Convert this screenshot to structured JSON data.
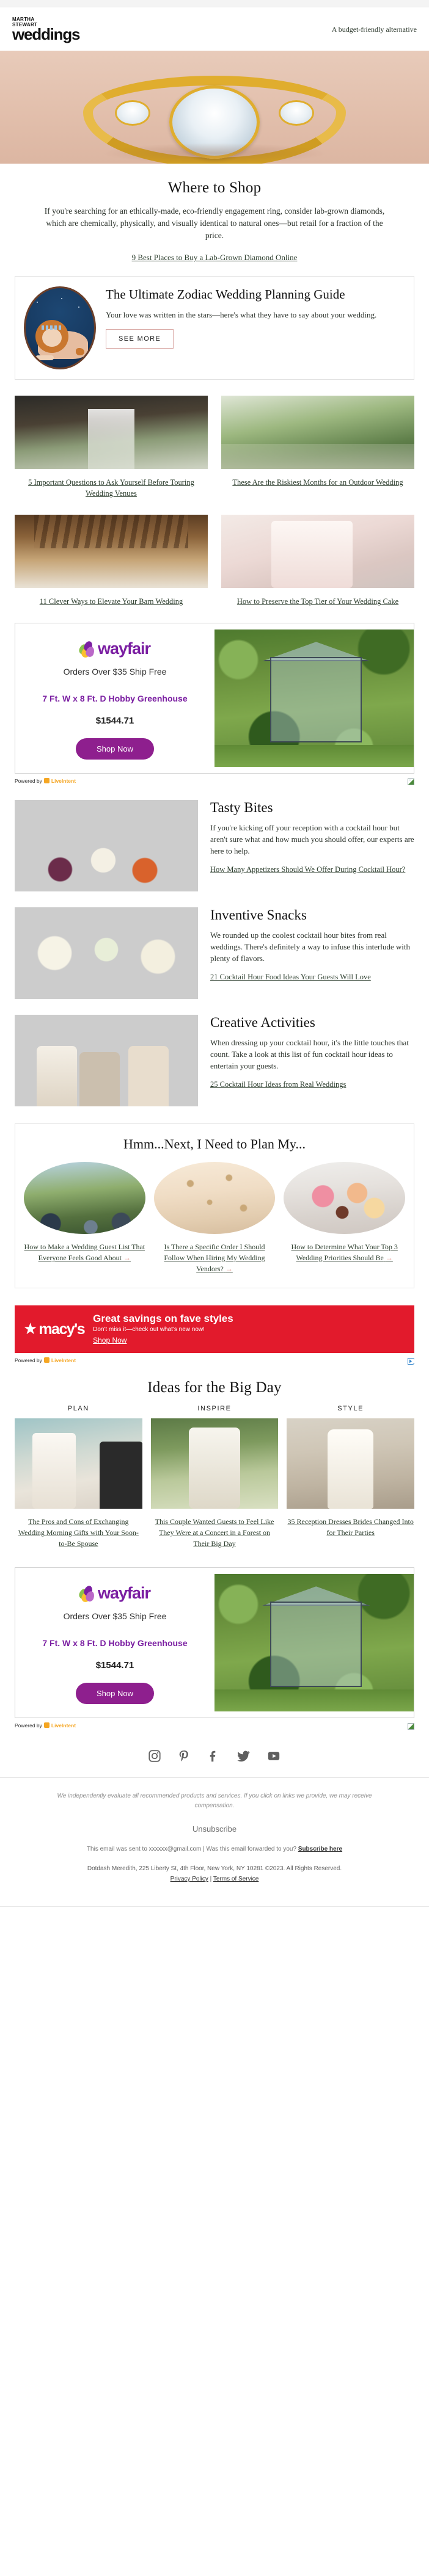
{
  "header": {
    "logo_line1": "MARTHA",
    "logo_line2": "STEWART",
    "logo_line3": "weddings",
    "preheader": "A budget-friendly alternative"
  },
  "hero": {
    "alt": "gold engagement ring with round diamond"
  },
  "where_to_shop": {
    "title": "Where to Shop",
    "body": "If you're searching for an ethically-made, eco-friendly engagement ring, consider lab-grown diamonds, which are chemically, physically, and visually identical to natural ones—but retail for a fraction of the price.",
    "link": "9 Best Places to Buy a Lab-Grown Diamond Online"
  },
  "zodiac_card": {
    "title": "The Ultimate Zodiac Wedding Planning Guide",
    "desc": "Your love was written in the stars—here's what they have to say about your wedding.",
    "button": "SEE MORE",
    "image_alt": "leo lion zodiac illustration"
  },
  "articles_grid": [
    {
      "link": "5 Important Questions to Ask Yourself Before Touring Wedding Venues",
      "image_alt": "wedding ceremony aisle"
    },
    {
      "link": "These Are the Riskiest Months for an Outdoor Wedding",
      "image_alt": "outdoor garden wedding"
    },
    {
      "link": "11 Clever Ways to Elevate Your Barn Wedding",
      "image_alt": "barn wedding reception"
    },
    {
      "link": "How to Preserve the Top Tier of Your Wedding Cake",
      "image_alt": "white wedding cake tier"
    }
  ],
  "wayfair_ad": {
    "brand": "wayfair",
    "shipping": "Orders Over $35 Ship Free",
    "product": "7 Ft. W x 8 Ft. D Hobby Greenhouse",
    "price": "$1544.71",
    "cta": "Shop Now",
    "powered_by": "Powered by",
    "network": "LiveIntent",
    "image_alt": "glass hobby greenhouse in garden"
  },
  "content_rows": [
    {
      "title": "Tasty Bites",
      "desc": "If you're kicking off your reception with a cocktail hour but aren't sure what and how much you should offer, our experts are here to help.",
      "link": "How Many Appetizers Should We Offer During Cocktail Hour?",
      "image_alt": "charcuterie board with cheese and grapes"
    },
    {
      "title": "Inventive Snacks",
      "desc": "We rounded up the coolest cocktail hour bites from real weddings. There's definitely a way to infuse this interlude with plenty of flavors.",
      "link": "21 Cocktail Hour Food Ideas Your Guests Will Love",
      "image_alt": "tray of green cocktail hour snacks"
    },
    {
      "title": "Creative Activities",
      "desc": "When dressing up your cocktail hour, it's the little touches that count. Take a look at this list of fun cocktail hour ideas to entertain your guests.",
      "link": "25 Cocktail Hour Ideas from Real Weddings",
      "image_alt": "guests at outdoor cocktail hour"
    }
  ],
  "plan_panel": {
    "title": "Hmm...Next, I Need to Plan My...",
    "items": [
      {
        "link": "How to Make a Wedding Guest List That Everyone Feels Good About",
        "arrow": "→",
        "image_alt": "wedding guests by the water"
      },
      {
        "link": "Is There a Specific Order I Should Follow When Hiring My Wedding Vendors?",
        "arrow": "→",
        "image_alt": "star decorations at reception"
      },
      {
        "link": "How to Determine What Your Top 3 Wedding Priorities Should Be",
        "arrow": "→",
        "image_alt": "pink and peach floral arrangement"
      }
    ]
  },
  "macys_ad": {
    "brand": "macy's",
    "headline": "Great savings on fave styles",
    "subline": "Don't miss it—check out what's new now!",
    "cta": "Shop Now",
    "powered_by": "Powered by",
    "network": "LiveIntent"
  },
  "big_day": {
    "title": "Ideas for the Big Day",
    "columns": [
      {
        "category": "PLAN",
        "link": "The Pros and Cons of Exchanging Wedding Morning Gifts with Your Soon-to-Be Spouse",
        "image_alt": "bride getting ready"
      },
      {
        "category": "INSPIRE",
        "link": "This Couple Wanted Guests to Feel Like They Were at a Concert in a Forest on Their Big Day",
        "image_alt": "forest wedding ceremony"
      },
      {
        "category": "STYLE",
        "link": "35 Reception Dresses Brides Changed Into for Their Parties",
        "image_alt": "bride in reception dress"
      }
    ]
  },
  "social": [
    {
      "name": "instagram-icon",
      "label": "Instagram"
    },
    {
      "name": "pinterest-icon",
      "label": "Pinterest"
    },
    {
      "name": "facebook-icon",
      "label": "Facebook"
    },
    {
      "name": "twitter-icon",
      "label": "Twitter"
    },
    {
      "name": "youtube-icon",
      "label": "YouTube"
    }
  ],
  "footer": {
    "disclaimer": "We independently evaluate all recommended products and services. If you click on links we provide, we may receive compensation.",
    "unsubscribe": "Unsubscribe",
    "sent_prefix": "This email was sent to xxxxxx@gmail.com  |  Was this email forwarded to you?",
    "subscribe_link": "Subscribe here",
    "address": "Dotdash Meredith, 225 Liberty St, 4th Floor, New York, NY 10281 ©2023. All Rights Reserved.",
    "privacy": "Privacy Policy",
    "separator": "|",
    "terms": "Terms of Service"
  },
  "colors": {
    "hero_bg": "#e3c3b0",
    "wayfair_purple": "#7b1fa2",
    "macys_red": "#e21a2c",
    "link_green": "#2f4030",
    "accent_pink": "#d9a8a4"
  }
}
